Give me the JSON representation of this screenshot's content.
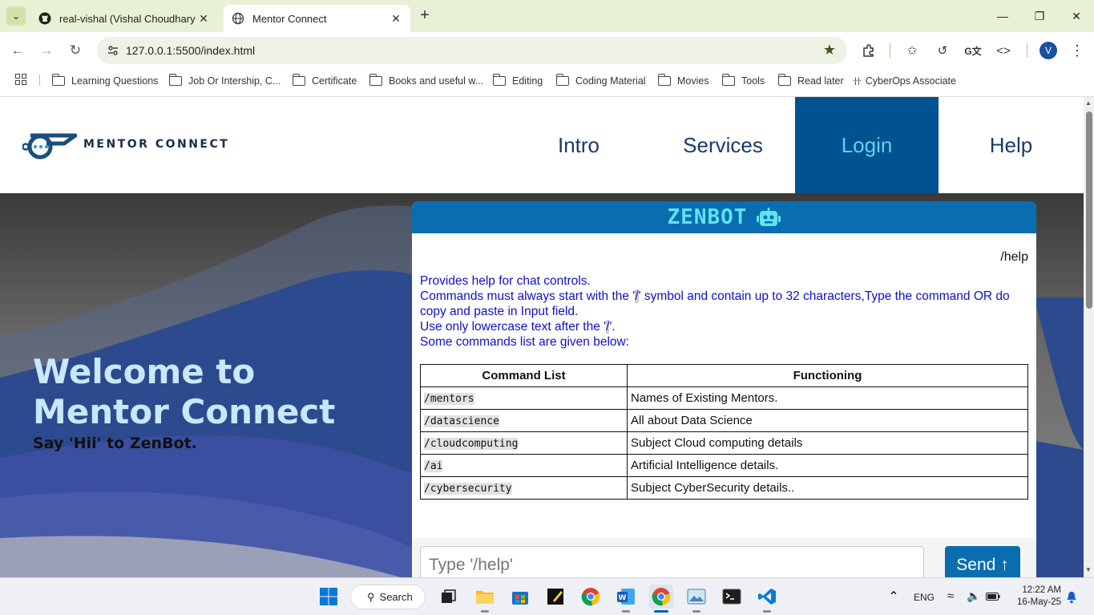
{
  "browser": {
    "tabs": [
      {
        "title": "real-vishal (Vishal Choudhary)",
        "active": false
      },
      {
        "title": "Mentor Connect",
        "active": true
      }
    ],
    "url": "127.0.0.1:5500/index.html",
    "profile_initial": "V",
    "bookmarks": [
      "Learning Questions",
      "Job Or Intership,  C...",
      "Certificate",
      "Books and useful w...",
      "Editing",
      "Coding Material",
      "Movies",
      "Tools",
      "Read later",
      "CyberOps Associate"
    ]
  },
  "site": {
    "logo_text": "MENTOR CONNECT",
    "nav": {
      "intro": "Intro",
      "services": "Services",
      "login": "Login",
      "help": "Help"
    },
    "hero": {
      "title_line1": "Welcome to",
      "title_line2": "Mentor Connect",
      "subtitle": "Say 'Hii' to ZenBot."
    }
  },
  "chatbot": {
    "title": "ZENBOT",
    "user_message": "/help",
    "bot_message": {
      "line1": "Provides help for chat controls.",
      "line2_a": "Commands must always start with the '",
      "slash": "/",
      "line2_b": "' symbol and contain up to 32 characters,Type the command OR do copy and paste in Input field.",
      "line3_a": "Use only lowercase text after the '",
      "line3_b": "'.",
      "line4": "Some commands list are given below:"
    },
    "table": {
      "headers": [
        "Command List",
        "Functioning"
      ],
      "rows": [
        {
          "command": "/mentors",
          "function": "Names of Existing Mentors."
        },
        {
          "command": "/datascience",
          "function": "All about Data Science"
        },
        {
          "command": "/cloudcomputing",
          "function": "Subject Cloud computing details"
        },
        {
          "command": "/ai",
          "function": "Artificial Intelligence details."
        },
        {
          "command": "/cybersecurity",
          "function": "Subject CyberSecurity details.."
        }
      ]
    },
    "input_placeholder": "Type  '/help'",
    "send_label": "Send ↑"
  },
  "taskbar": {
    "search_label": "Search",
    "language": "ENG",
    "time": "12:22 AM",
    "date": "16-May-25"
  },
  "colors": {
    "nav_active_bg": "#005291",
    "nav_active_text": "#5ed4ef",
    "chat_header": "#0a6db0",
    "bot_text": "#1010c8",
    "hero_title": "#c8e8fb"
  }
}
